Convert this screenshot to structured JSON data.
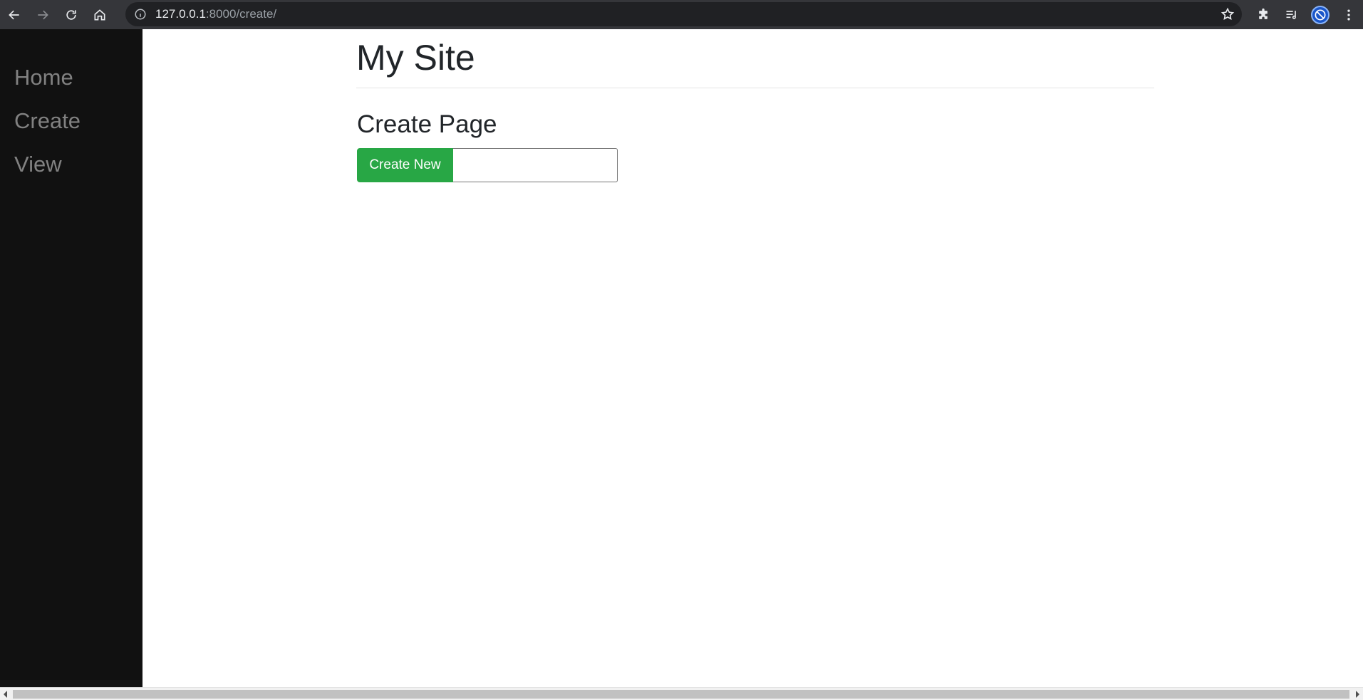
{
  "browser": {
    "url_host": "127.0.0.1",
    "url_rest": ":8000/create/",
    "icons": [
      "back-arrow-icon",
      "forward-arrow-icon",
      "reload-icon",
      "home-icon",
      "info-icon",
      "star-icon",
      "extensions-icon",
      "media-queue-icon",
      "profile-avatar-icon",
      "more-menu-icon"
    ]
  },
  "sidebar": {
    "items": [
      {
        "label": "Home"
      },
      {
        "label": "Create"
      },
      {
        "label": "View"
      }
    ]
  },
  "main": {
    "site_title": "My Site",
    "page_title": "Create Page",
    "form": {
      "button_label": "Create New",
      "input_value": ""
    }
  },
  "colors": {
    "sidebar_bg": "#111111",
    "sidebar_link": "#818181",
    "button_green": "#28a745",
    "chrome_bg": "#35363a"
  }
}
